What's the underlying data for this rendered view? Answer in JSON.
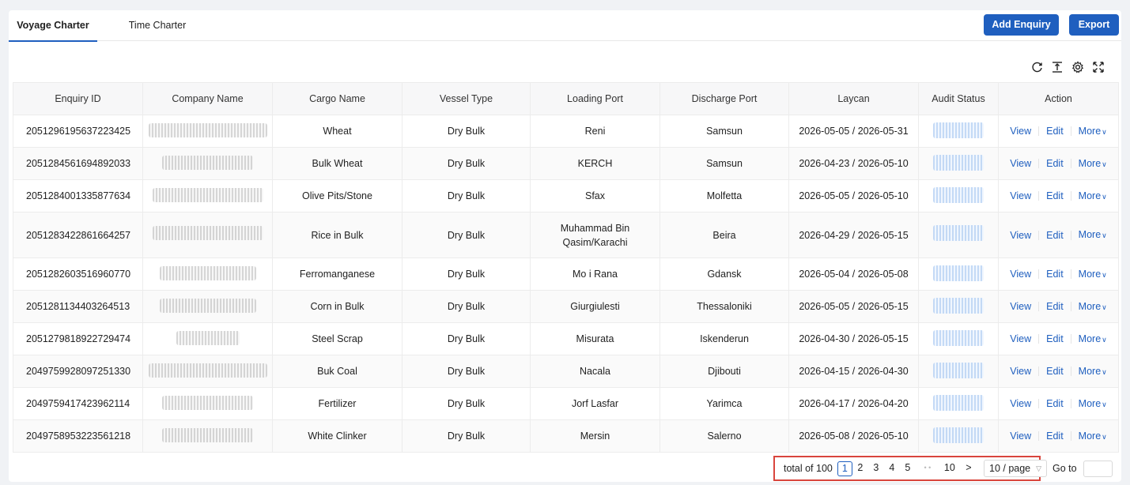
{
  "tabs": [
    {
      "label": "Voyage Charter",
      "active": true
    },
    {
      "label": "Time Charter",
      "active": false
    }
  ],
  "toolbar": {
    "add_label": "Add Enquiry",
    "export_label": "Export"
  },
  "table_tools": [
    "refresh-icon",
    "column-height-icon",
    "settings-icon",
    "fullscreen-icon"
  ],
  "columns": [
    "Enquiry ID",
    "Company Name",
    "Cargo Name",
    "Vessel Type",
    "Loading Port",
    "Discharge Port",
    "Laycan",
    "Audit Status",
    "Action"
  ],
  "actions": {
    "view": "View",
    "edit": "Edit",
    "more": "More"
  },
  "rows": [
    {
      "id": "2051296195637223425",
      "cargo": "Wheat",
      "vessel": "Dry Bulk",
      "loading": "Reni",
      "discharge": "Samsun",
      "laycan": "2026-05-05 / 2026-05-31"
    },
    {
      "id": "2051284561694892033",
      "cargo": "Bulk Wheat",
      "vessel": "Dry Bulk",
      "loading": "KERCH",
      "discharge": "Samsun",
      "laycan": "2026-04-23 / 2026-05-10"
    },
    {
      "id": "2051284001335877634",
      "cargo": "Olive Pits/Stone",
      "vessel": "Dry Bulk",
      "loading": "Sfax",
      "discharge": "Molfetta",
      "laycan": "2026-05-05 / 2026-05-10"
    },
    {
      "id": "2051283422861664257",
      "cargo": "Rice in Bulk",
      "vessel": "Dry Bulk",
      "loading": "Muhammad Bin Qasim/Karachi",
      "discharge": "Beira",
      "laycan": "2026-04-29 / 2026-05-15"
    },
    {
      "id": "2051282603516960770",
      "cargo": "Ferromanganese",
      "vessel": "Dry Bulk",
      "loading": "Mo i Rana",
      "discharge": "Gdansk",
      "laycan": "2026-05-04 / 2026-05-08"
    },
    {
      "id": "2051281134403264513",
      "cargo": "Corn in Bulk",
      "vessel": "Dry Bulk",
      "loading": "Giurgiulesti",
      "discharge": "Thessaloniki",
      "laycan": "2026-05-05 / 2026-05-15"
    },
    {
      "id": "2051279818922729474",
      "cargo": "Steel Scrap",
      "vessel": "Dry Bulk",
      "loading": "Misurata",
      "discharge": "Iskenderun",
      "laycan": "2026-04-30 / 2026-05-15"
    },
    {
      "id": "2049759928097251330",
      "cargo": "Buk Coal",
      "vessel": "Dry Bulk",
      "loading": "Nacala",
      "discharge": "Djibouti",
      "laycan": "2026-04-15 / 2026-04-30"
    },
    {
      "id": "2049759417423962114",
      "cargo": "Fertilizer",
      "vessel": "Dry Bulk",
      "loading": "Jorf Lasfar",
      "discharge": "Yarimca",
      "laycan": "2026-04-17 / 2026-04-20"
    },
    {
      "id": "2049758953223561218",
      "cargo": "White Clinker",
      "vessel": "Dry Bulk",
      "loading": "Mersin",
      "discharge": "Salerno",
      "laycan": "2026-05-08 / 2026-05-10"
    }
  ],
  "pagination": {
    "total_label": "total of 100",
    "pages": [
      "1",
      "2",
      "3",
      "4",
      "5"
    ],
    "ellipsis": "• •",
    "last_page": "10",
    "next": ">",
    "current": "1",
    "page_size": "10 / page",
    "goto_label": "Go to"
  }
}
